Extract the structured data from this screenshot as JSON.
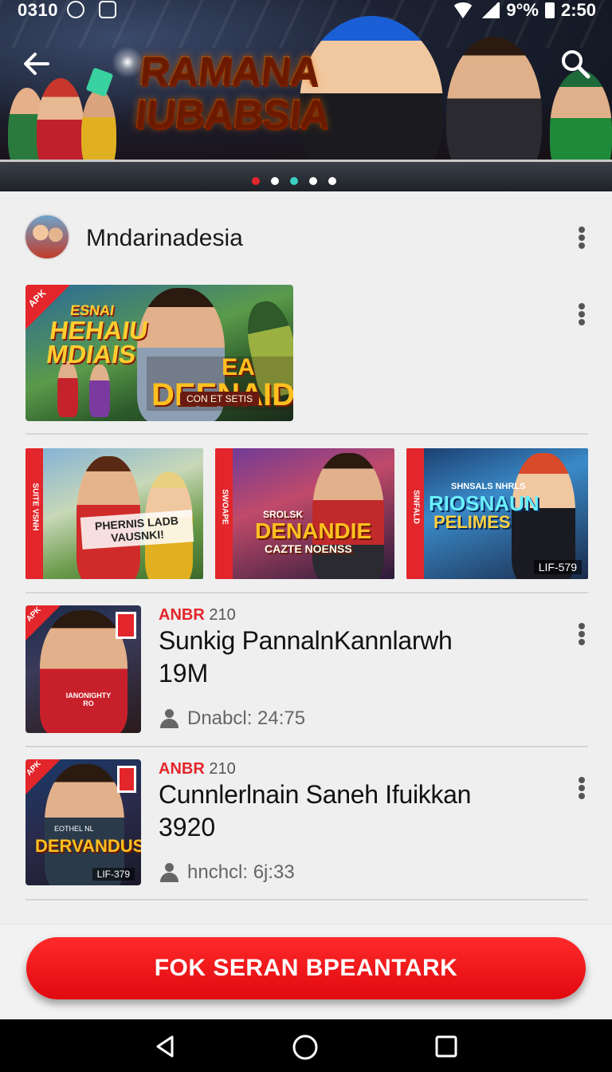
{
  "status_bar": {
    "left_text": "0310",
    "battery_text": "9°%",
    "time": "2:50"
  },
  "banner": {
    "title_line1": "RAMANA",
    "title_line2": "IUBABSIA",
    "page_dots": 5,
    "active_dot": 0
  },
  "channel": {
    "name": "Mndarinadesia"
  },
  "featured": {
    "corner": "APK",
    "line1": "ESNAI",
    "line2": "HEHAIU",
    "line3": "MDIAIS",
    "big1": "EA",
    "big2": "DEENAIDIS",
    "subtitle": "CON ET SETIS"
  },
  "carousel": [
    {
      "stripe": "SUITE VSNH",
      "title": "PHERNIS LADB VAUSNKI!",
      "tag": ""
    },
    {
      "stripe": "SWOAPE",
      "subtitle": "SROLSK",
      "title": "DENANDIE",
      "title2": "CAZTE NOENSS",
      "tag": ""
    },
    {
      "stripe": "SINFALD",
      "subtitle": "SHNSALS NHRLS",
      "title": "RIOSNAUN",
      "title2": "PELIMES",
      "tag": "LIF-579"
    }
  ],
  "videos": [
    {
      "corner": "APK",
      "category": "ANBR",
      "category_num": "210",
      "title": "Sunkig PannalnKannlarwh",
      "count": "19M",
      "sub": "Dnabcl: 24:75",
      "thumb_caption": "IANONIGHTY RO"
    },
    {
      "corner": "APK",
      "category": "ANBR",
      "category_num": "210",
      "title": "Cunnlerlnain Saneh Ifuikkan",
      "count": "3920",
      "sub": "hnchcl: 6j:33",
      "thumb_caption": "DERVANDUS",
      "thumb_tag": "LIF-379",
      "thumb_top": "EOTHEL NL"
    }
  ],
  "cta": {
    "label": "FOK SERAN BPEANTARK"
  },
  "colors": {
    "accent": "#e3262b",
    "background": "#efefef",
    "nav": "#000000"
  }
}
